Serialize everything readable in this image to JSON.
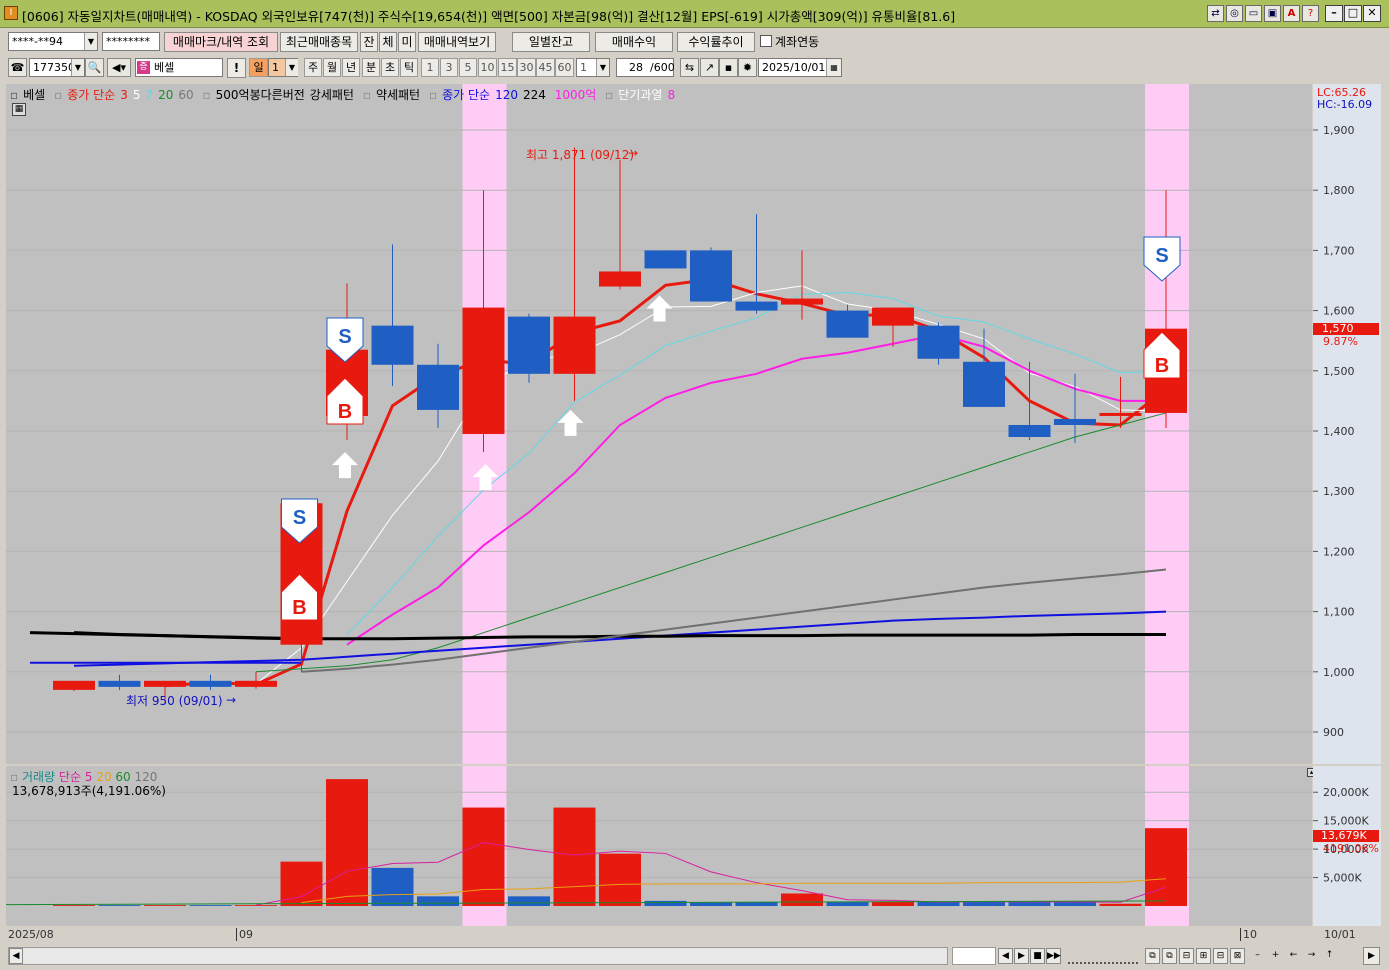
{
  "window": {
    "title": "[0606] 자동일지차트(매매내역) - KOSDAQ 외국인보유[747(천)] 주식수[19,654(천)] 액면[500] 자본금[98(억)] 결산[12월] EPS[-619] 시가총액[309(억)] 유통비율[81.6]",
    "app_icon": "I",
    "titlebar_color": "#a9c05d"
  },
  "toolbar1": {
    "account": "****-**94",
    "password": "********",
    "btn_mark": "매매마크/내역 조회",
    "btn_recent": "최근매매종목",
    "btn_jan": "잔",
    "btn_che": "체",
    "btn_mi": "미",
    "btn_history": "매매내역보기",
    "btn_daily": "일별잔고",
    "btn_profit": "매매수익",
    "btn_rate": "수익률추이",
    "chk_account": "계좌연동"
  },
  "toolbar2": {
    "code": "177350",
    "stock_name": "베셀",
    "stock_badge": "증",
    "period_selected": "일",
    "period_num": "1",
    "periods": [
      "주",
      "월",
      "년",
      "분",
      "초",
      "틱"
    ],
    "intervals": [
      "1",
      "3",
      "5",
      "10",
      "15",
      "30",
      "45",
      "60"
    ],
    "interval_sel": "1",
    "count": "28",
    "count_total": "/600",
    "date": "2025/10/01",
    "exclaim": "!"
  },
  "legend": {
    "name": "베셀",
    "ma_label": "종가 단순",
    "ma_periods": [
      "3",
      "5",
      "7",
      "20",
      "60"
    ],
    "pattern1": "500억봉다른버전",
    "pattern2": "강세패턴",
    "pattern3": "약세패턴",
    "ma2_label": "종가 단순",
    "ma2_periods": [
      "120",
      "224"
    ],
    "big": "1000억",
    "over": "단기과열",
    "over_n": "8"
  },
  "annotations": {
    "high": "최고 1,871 (09/12)",
    "low": "최저 950 (09/01)"
  },
  "price_axis": {
    "lc": "LC:65.26",
    "hc": "HC:-16.09",
    "ticks": [
      "1,900",
      "1,800",
      "1,700",
      "1,600",
      "1,500",
      "1,400",
      "1,300",
      "1,200",
      "1,100",
      "1,000",
      "900"
    ],
    "current": "1,570",
    "current_pct": "9.87%"
  },
  "volume": {
    "legend_name": "거래량",
    "legend_ma": "단순",
    "legend_periods": [
      "5",
      "20",
      "60",
      "120"
    ],
    "info": "13,678,913주(4,191.06%)",
    "ticks": [
      "20,000K",
      "15,000K",
      "10,000K",
      "5,000K"
    ],
    "current": "13,679K",
    "current_pct": "4191.06%"
  },
  "date_axis": {
    "labels": [
      "2025/08",
      "09",
      "10",
      "10/01"
    ]
  },
  "colors": {
    "up": "#e8190f",
    "down": "#1f5fc4",
    "highlight": "#ffccf5",
    "chart_bg": "#c0c0c0"
  },
  "chart_data": {
    "type": "candlestick",
    "dates": [
      "08/28",
      "08/29",
      "09/01",
      "09/02",
      "09/03",
      "09/04",
      "09/05",
      "09/08",
      "09/09",
      "09/10",
      "09/11",
      "09/12",
      "09/15",
      "09/16",
      "09/17",
      "09/18",
      "09/19",
      "09/22",
      "09/23",
      "09/24",
      "09/25",
      "09/26",
      "09/29",
      "09/30",
      "10/01"
    ],
    "open": [
      970,
      985,
      975,
      985,
      975,
      1045,
      1425,
      1575,
      1510,
      1395,
      1590,
      1495,
      1640,
      1700,
      1700,
      1615,
      1610,
      1600,
      1575,
      1575,
      1515,
      1410,
      1420,
      1425,
      1430
    ],
    "high": [
      985,
      995,
      985,
      995,
      1000,
      1280,
      1645,
      1710,
      1545,
      1800,
      1595,
      1871,
      1850,
      1700,
      1705,
      1760,
      1700,
      1610,
      1600,
      1580,
      1570,
      1515,
      1495,
      1490,
      1800
    ],
    "low": [
      968,
      970,
      950,
      970,
      972,
      1000,
      1385,
      1475,
      1405,
      1365,
      1480,
      1450,
      1635,
      1670,
      1650,
      1595,
      1585,
      1590,
      1540,
      1510,
      1500,
      1385,
      1380,
      1405,
      1405
    ],
    "close": [
      985,
      975,
      985,
      975,
      985,
      1280,
      1535,
      1510,
      1435,
      1605,
      1495,
      1590,
      1665,
      1670,
      1615,
      1600,
      1620,
      1555,
      1605,
      1520,
      1440,
      1390,
      1410,
      1430,
      1570
    ],
    "volume_k": [
      150,
      150,
      150,
      150,
      150,
      7800,
      22300,
      6700,
      1700,
      17300,
      1700,
      17300,
      9200,
      900,
      600,
      700,
      2200,
      700,
      700,
      700,
      800,
      700,
      700,
      400,
      13679
    ],
    "ma_series": [
      {
        "name": "3",
        "color": "#e8190f",
        "values": [
          null,
          null,
          977,
          982,
          979,
          1013,
          1267,
          1442,
          1493,
          1517,
          1512,
          1563,
          1583,
          1642,
          1652,
          1628,
          1612,
          1592,
          1593,
          1567,
          1522,
          1450,
          1413,
          1410,
          1470
        ]
      },
      {
        "name": "5",
        "color": "#ffffff",
        "values": [
          null,
          null,
          null,
          null,
          980,
          1040,
          1150,
          1260,
          1350,
          1473,
          1518,
          1527,
          1560,
          1606,
          1607,
          1630,
          1641,
          1611,
          1600,
          1577,
          1553,
          1496,
          1474,
          1435,
          1433
        ]
      },
      {
        "name": "7",
        "color": "#5fd9e6",
        "values": [
          null,
          null,
          null,
          null,
          null,
          null,
          1061,
          1140,
          1225,
          1302,
          1363,
          1448,
          1493,
          1542,
          1566,
          1588,
          1627,
          1630,
          1620,
          1591,
          1581,
          1553,
          1528,
          1497,
          1498
        ]
      },
      {
        "name": "20",
        "color": "#ff1ee6",
        "values": [
          null,
          null,
          null,
          null,
          null,
          null,
          1045,
          1095,
          1140,
          1210,
          1265,
          1330,
          1410,
          1455,
          1480,
          1495,
          1520,
          1530,
          1545,
          1560,
          1540,
          1500,
          1470,
          1450,
          1450
        ]
      },
      {
        "name": "60",
        "color": "#1a8a2a",
        "values": [
          null,
          null,
          null,
          null,
          1000,
          1005,
          1010,
          1020,
          1040,
          1065,
          1090,
          1115,
          1140,
          1165,
          1190,
          1215,
          1240,
          1265,
          1290,
          1315,
          1340,
          1365,
          1390,
          1410,
          1430
        ]
      },
      {
        "name": "120",
        "color": "#1010e0",
        "values": [
          1010,
          1012,
          1014,
          1016,
          1018,
          1020,
          1025,
          1030,
          1035,
          1040,
          1045,
          1050,
          1055,
          1060,
          1065,
          1070,
          1075,
          1080,
          1085,
          1088,
          1090,
          1093,
          1095,
          1097,
          1100
        ]
      },
      {
        "name": "224",
        "color": "#000000",
        "values": [
          1065,
          1062,
          1060,
          1058,
          1056,
          1055,
          1055,
          1055,
          1056,
          1057,
          1058,
          1058,
          1059,
          1059,
          1060,
          1060,
          1060,
          1061,
          1061,
          1061,
          1061,
          1061,
          1062,
          1062,
          1062
        ]
      },
      {
        "name": "long",
        "color": "#707070",
        "values": [
          null,
          null,
          null,
          null,
          null,
          1000,
          1005,
          1012,
          1020,
          1030,
          1040,
          1050,
          1060,
          1070,
          1080,
          1090,
          1100,
          1110,
          1120,
          1130,
          1140,
          1148,
          1155,
          1162,
          1170
        ]
      }
    ],
    "buy_marks": [
      "09/04",
      "09/05",
      "10/01"
    ],
    "sell_marks": [
      "09/04",
      "09/05",
      "10/01"
    ],
    "ylim": [
      860,
      1960
    ]
  }
}
